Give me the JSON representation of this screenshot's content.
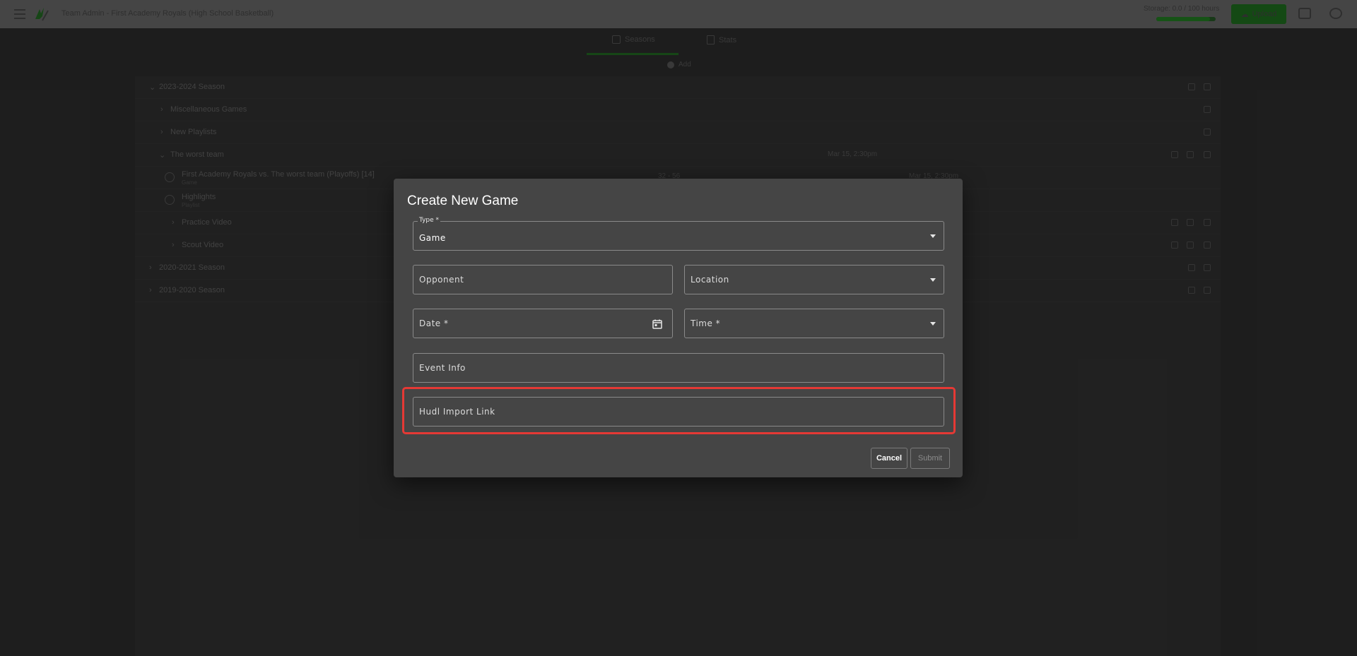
{
  "app": {
    "title": "Team Admin - First Academy Royals (High School Basketball)",
    "storage": "Storage: 0.0 / 100 hours",
    "upload_label": "Upload"
  },
  "tabs": [
    {
      "label": "Seasons"
    },
    {
      "label": "Stats"
    }
  ],
  "add_label": "Add",
  "tree": {
    "season_1": {
      "label": "2023-2024 Season"
    },
    "misc": {
      "label": "Miscellaneous Games"
    },
    "new_playlist": {
      "label": "New Playlists"
    },
    "team": {
      "label": "The worst team",
      "date": "Mar 15, 2:30pm"
    },
    "game": {
      "label": "First Academy Royals vs. The worst team (Playoffs) [14]",
      "sub": "Game",
      "score": "32 - 56",
      "date": "Mar 15, 2:30pm"
    },
    "highlights": {
      "label": "Highlights",
      "sub": "Playlist"
    },
    "practice": {
      "label": "Practice Video"
    },
    "scout": {
      "label": "Scout Video"
    },
    "season_2": {
      "label": "2020-2021 Season"
    },
    "season_3": {
      "label": "2019-2020 Season"
    }
  },
  "dialog": {
    "title": "Create New Game",
    "type_label": "Type *",
    "type_value": "Game",
    "opponent_placeholder": "Opponent",
    "location_placeholder": "Location",
    "date_placeholder": "Date *",
    "time_placeholder": "Time *",
    "event_info_placeholder": "Event Info",
    "hudl_placeholder": "Hudl Import Link",
    "cancel_label": "Cancel",
    "submit_label": "Submit"
  },
  "colors": {
    "highlight": "#e53935",
    "dialog_bg": "#454545",
    "accent_green": "#1a5e1a"
  }
}
